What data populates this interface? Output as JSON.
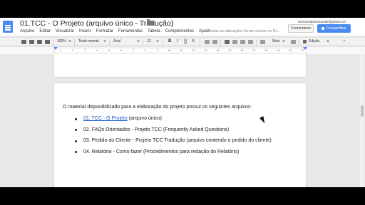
{
  "header": {
    "title": "01.TCC - O Projeto (arquivo único - Tradução)",
    "user_email": "simonevalasereanale@gmail.com",
    "comments_label": "Comentários",
    "share_label": "Compartilhar",
    "save_status": "Todas as alterações foram salvas no Dr..."
  },
  "menu": [
    "Arquivo",
    "Editar",
    "Visualizar",
    "Inserir",
    "Formatar",
    "Ferramentas",
    "Tabela",
    "Complementos",
    "Ajuda"
  ],
  "toolbar": {
    "zoom": "100%",
    "style": "Texto normal",
    "font": "Arial",
    "size": "12",
    "more": "Mais",
    "mode": "Edição"
  },
  "ruler": {
    "numbers": [
      "1",
      "2",
      "3",
      "4",
      "5",
      "6",
      "7",
      "8",
      "9",
      "10",
      "11",
      "12",
      "13",
      "14",
      "15",
      "16",
      "17",
      "18",
      "19",
      "20",
      "21"
    ]
  },
  "document": {
    "intro": "O material disponibilizado para a elaboração do projeto possui os seguintes arquivos:",
    "items": [
      {
        "link": "01. TCC - O Projeto",
        "text": " (arquivo único)"
      },
      {
        "link": "",
        "text": "02. FAQs Orientados - Projeto TCC (Frequently Asked Questions)"
      },
      {
        "link": "",
        "text": "03. Pedido do Cliente - Projeto TCC Tradução (arquivo contendo o pedido do cliente)"
      },
      {
        "link": "",
        "text": "04. Relatório - Como fazer (Procedimentos para redação do Relatório)"
      }
    ]
  },
  "colors": {
    "accent": "#4a8af4",
    "link": "#1155cc"
  }
}
